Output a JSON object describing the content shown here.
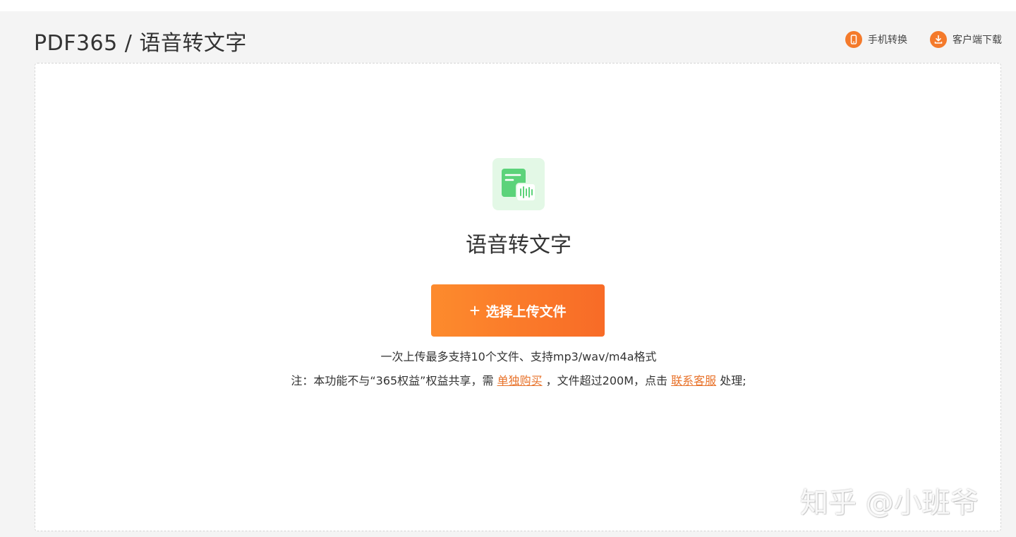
{
  "header": {
    "title": "PDF365 / 语音转文字",
    "actions": [
      {
        "label": "手机转换",
        "icon": "phone-icon"
      },
      {
        "label": "客户端下载",
        "icon": "download-icon"
      }
    ]
  },
  "main": {
    "feature_icon": "audio-to-text-icon",
    "feature_name": "语音转文字",
    "upload_button": "选择上传文件",
    "hint": "一次上传最多支持10个文件、支持mp3/wav/m4a格式",
    "note": {
      "prefix": "注：本功能不与“365权益”权益共享，需",
      "buy_link": "单独购买",
      "middle": "，文件超过200M，点击",
      "service_link": "联系客服",
      "suffix": "处理;"
    }
  },
  "watermark": "知乎 @小班爷",
  "colors": {
    "accent": "#f47a2b",
    "button_gradient_start": "#fd8b2d",
    "button_gradient_end": "#f86b27",
    "icon_bg": "#e3f8e6",
    "icon_green": "#5cd37a",
    "link": "#e8722a"
  }
}
